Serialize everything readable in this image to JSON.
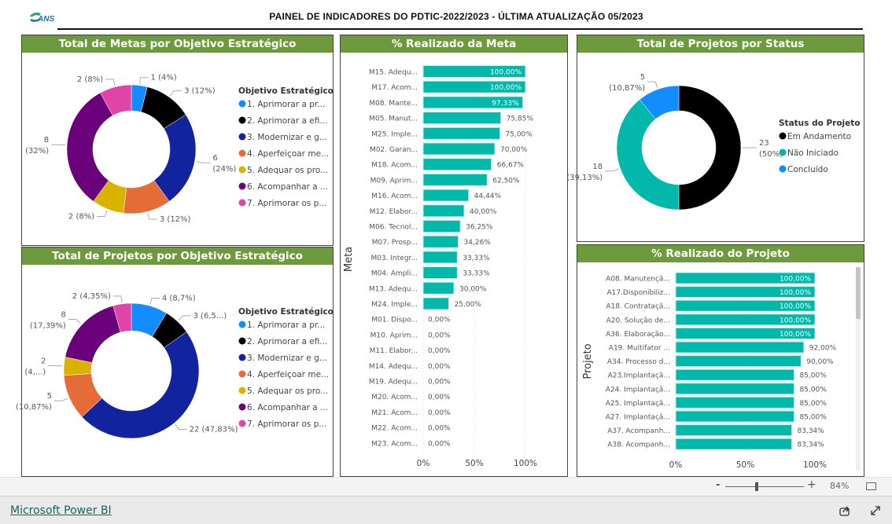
{
  "header": {
    "logo_text": "ANS",
    "title": "PAINEL DE INDICADORES DO PDTIC-2022/2023 - ÚLTIMA ATUALIZAÇÃO 05/2023"
  },
  "colors": {
    "accent": "#6e9a3e",
    "bar": "#01b8aa",
    "objetivo": [
      "#118dff",
      "#000000",
      "#12239e",
      "#e66c37",
      "#d9b300",
      "#6b007b",
      "#e044a7"
    ],
    "status": [
      "#000000",
      "#01b8aa",
      "#118dff"
    ]
  },
  "chart_data": [
    {
      "type": "pie",
      "variant": "donut",
      "title": "Total de Metas por Objetivo Estratégico",
      "legend_title": "Objetivo Estratégico",
      "legend_position": "right",
      "categories": [
        "1. Aprimorar a pr...",
        "2. Aprimorar a efi...",
        "3. Modernizar e g...",
        "4. Aperfeiçoar me...",
        "5. Adequar os pro...",
        "6. Acompanhar a ...",
        "7. Aprimorar os p..."
      ],
      "values": [
        1,
        3,
        6,
        3,
        2,
        8,
        2
      ],
      "labels": [
        "1 (4%)",
        "3 (12%)",
        "6\n(24%)",
        "3 (12%)",
        "2 (8%)",
        "8\n(32%)",
        "2 (8%)"
      ]
    },
    {
      "type": "pie",
      "variant": "donut",
      "title": "Total de Projetos por Objetivo Estratégico",
      "legend_title": "Objetivo Estratégico",
      "legend_position": "right",
      "categories": [
        "1. Aprimorar a pr...",
        "2. Aprimorar a efi...",
        "3. Modernizar e g...",
        "4. Aperfeiçoar me...",
        "5. Adequar os pro...",
        "6. Acompanhar a ...",
        "7. Aprimorar os p..."
      ],
      "values": [
        4,
        3,
        22,
        5,
        2,
        8,
        2
      ],
      "labels": [
        "4 (8,7%)",
        "3 (6,5...)",
        "22 (47,83%)",
        "5\n(10,87%)",
        "2\n(4,...)",
        "8\n(17,39%)",
        "2 (4,35%)"
      ]
    },
    {
      "type": "bar",
      "orientation": "horizontal",
      "title": "% Realizado da Meta",
      "ylabel": "Meta",
      "xlabel": "",
      "xlim": [
        0,
        100
      ],
      "xticks": [
        "0%",
        "50%",
        "100%"
      ],
      "grid": true,
      "categories": [
        "M15. Adequ...",
        "M17. Acom...",
        "M08. Mante...",
        "M05. Manut...",
        "M25. Imple...",
        "M02. Garan...",
        "M18. Acom...",
        "M09. Aprim...",
        "M16. Acom...",
        "M12. Elabor...",
        "M06. Tecnol...",
        "M07. Prosp...",
        "M03. Integr...",
        "M04. Ampli...",
        "M13. Adequ...",
        "M24. Imple...",
        "M01. Dispo...",
        "M10. Aprim...",
        "M11. Elabor...",
        "M14. Adequ...",
        "M19. Adequ...",
        "M20. Acom...",
        "M21. Acom...",
        "M22. Acom...",
        "M23. Acom..."
      ],
      "values": [
        100,
        100,
        97.33,
        75.85,
        75,
        70,
        66.67,
        62.5,
        44.44,
        40,
        36.25,
        34.26,
        33.33,
        33.33,
        30,
        25,
        0,
        0,
        0,
        0,
        0,
        0,
        0,
        0,
        0
      ],
      "labels": [
        "100,00%",
        "100,00%",
        "97,33%",
        "75,85%",
        "75,00%",
        "70,00%",
        "66,67%",
        "62,50%",
        "44,44%",
        "40,00%",
        "36,25%",
        "34,26%",
        "33,33%",
        "33,33%",
        "30,00%",
        "25,00%",
        "0,00%",
        "0,00%",
        "0,00%",
        "0,00%",
        "0,00%",
        "0,00%",
        "0,00%",
        "0,00%",
        "0,00%"
      ]
    },
    {
      "type": "pie",
      "variant": "donut",
      "title": "Total de Projetos por Status",
      "legend_title": "Status do Projeto",
      "legend_position": "right",
      "categories": [
        "Em Andamento",
        "Não Iniciado",
        "Concluído"
      ],
      "values": [
        23,
        18,
        5
      ],
      "labels": [
        "23\n(50%)",
        "18\n(39,13%)",
        "5\n(10,87%)"
      ]
    },
    {
      "type": "bar",
      "orientation": "horizontal",
      "title": "% Realizado do Projeto",
      "ylabel": "Projeto",
      "xlabel": "",
      "xlim": [
        0,
        100
      ],
      "xticks": [
        "0%",
        "50%",
        "100%"
      ],
      "grid": true,
      "categories": [
        "A08. Manutençã...",
        "A17.Disponibiliz...",
        "A18. Contrataçã...",
        "A20. Solução de...",
        "A36. Elaboração...",
        "A19. Multifator ...",
        "A34. Processo d...",
        "A23.Implantaçã...",
        "A24. Implantaçã...",
        "A25. Implantaçã...",
        "A27. Implantaçã...",
        "A37. Acompanh...",
        "A38. Acompanh..."
      ],
      "values": [
        100,
        100,
        100,
        100,
        100,
        92,
        90,
        85,
        85,
        85,
        85,
        83.34,
        83.34
      ],
      "labels": [
        "100,00%",
        "100,00%",
        "100,00%",
        "100,00%",
        "100,00%",
        "92,00%",
        "90,00%",
        "85,00%",
        "85,00%",
        "85,00%",
        "85,00%",
        "83,34%",
        "83,34%"
      ]
    }
  ],
  "footer": {
    "zoom_minus": "-",
    "zoom_plus": "+",
    "zoom_level": "84%",
    "zoom_value": 84,
    "powerbi_link": "Microsoft Power BI",
    "icons": [
      "fit-to-page-icon",
      "share-icon",
      "fullscreen-icon"
    ]
  }
}
